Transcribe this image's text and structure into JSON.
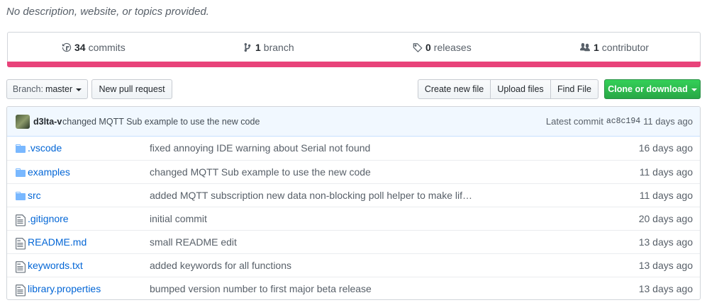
{
  "repo": {
    "description": "No description, website, or topics provided."
  },
  "summary": {
    "commits": {
      "count": "34",
      "label": "commits",
      "icon": "history-icon"
    },
    "branches": {
      "count": "1",
      "label": "branch",
      "icon": "branch-icon"
    },
    "releases": {
      "count": "0",
      "label": "releases",
      "icon": "tag-icon"
    },
    "contributors": {
      "count": "1",
      "label": "contributor",
      "icon": "people-icon"
    },
    "language_bar_color": "#e8437a"
  },
  "toolbar": {
    "branch_prefix": "Branch:",
    "branch_name": "master",
    "new_pr": "New pull request",
    "create_file": "Create new file",
    "upload_files": "Upload files",
    "find_file": "Find File",
    "clone": "Clone or download",
    "clone_color": "#28a745"
  },
  "latest_commit": {
    "author": "d3lta-v",
    "message": "changed MQTT Sub example to use the new code",
    "label": "Latest commit",
    "sha": "ac8c194",
    "age": "11 days ago"
  },
  "files": [
    {
      "type": "dir",
      "name": ".vscode",
      "message": "fixed annoying IDE warning about Serial not found",
      "age": "16 days ago"
    },
    {
      "type": "dir",
      "name": "examples",
      "message": "changed MQTT Sub example to use the new code",
      "age": "11 days ago"
    },
    {
      "type": "dir",
      "name": "src",
      "message": "added MQTT subscription new data non-blocking poll helper to make lif…",
      "age": "11 days ago"
    },
    {
      "type": "file",
      "name": ".gitignore",
      "message": "initial commit",
      "age": "20 days ago"
    },
    {
      "type": "file",
      "name": "README.md",
      "message": "small README edit",
      "age": "13 days ago"
    },
    {
      "type": "file",
      "name": "keywords.txt",
      "message": "added keywords for all functions",
      "age": "13 days ago"
    },
    {
      "type": "file",
      "name": "library.properties",
      "message": "bumped version number to first major beta release",
      "age": "13 days ago"
    }
  ]
}
